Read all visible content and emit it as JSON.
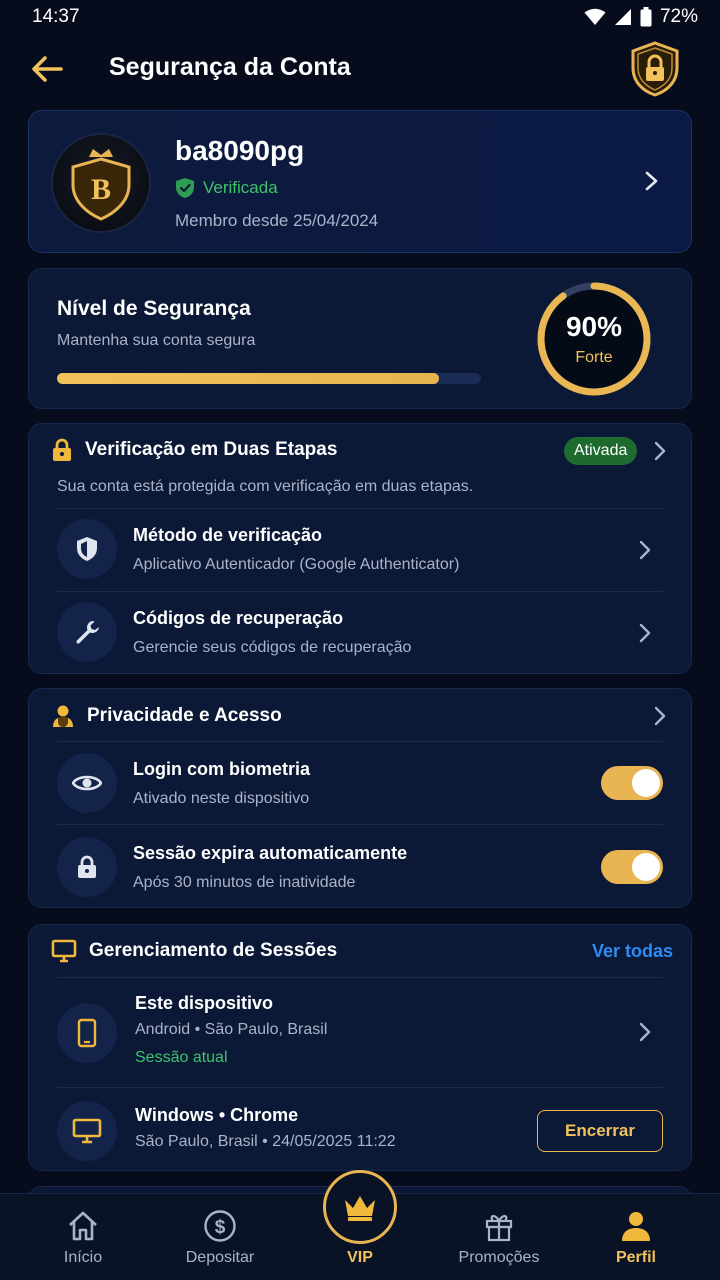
{
  "status": {
    "time": "14:37",
    "battery": "72%"
  },
  "header": {
    "title": "Segurança da Conta"
  },
  "profile": {
    "username": "ba8090pg",
    "verified_label": "Verificada",
    "member_since": "Membro desde 25/04/2024",
    "avatar_letter": "B"
  },
  "security_level": {
    "title": "Nível de Segurança",
    "subtitle": "Mantenha sua conta segura",
    "percent": 90,
    "percent_label": "90%",
    "strength": "Forte"
  },
  "two_factor": {
    "title": "Verificação em Duas Etapas",
    "status": "Ativada",
    "description": "Sua conta está protegida com verificação em duas etapas.",
    "items": [
      {
        "title": "Método de verificação",
        "subtitle": "Aplicativo Autenticador (Google Authenticator)"
      },
      {
        "title": "Códigos de recuperação",
        "subtitle": "Gerencie seus códigos de recuperação"
      }
    ]
  },
  "privacy": {
    "title": "Privacidade e Acesso",
    "items": [
      {
        "title": "Login com biometria",
        "subtitle": "Ativado neste dispositivo",
        "enabled": true
      },
      {
        "title": "Sessão expira automaticamente",
        "subtitle": "Após 30 minutos de inatividade",
        "enabled": true
      }
    ]
  },
  "sessions": {
    "title": "Gerenciamento de Sessões",
    "see_all": "Ver todas",
    "items": [
      {
        "title": "Este dispositivo",
        "subtitle": "Android • São Paulo, Brasil",
        "current_label": "Sessão atual"
      },
      {
        "title": "Windows • Chrome",
        "subtitle": "São Paulo, Brasil • 24/05/2025 11:22",
        "action": "Encerrar"
      }
    ]
  },
  "nav": {
    "items": [
      {
        "label": "Início",
        "icon": "home-icon"
      },
      {
        "label": "Depositar",
        "icon": "dollar-icon"
      },
      {
        "label": "VIP",
        "icon": "crown-icon"
      },
      {
        "label": "Promoções",
        "icon": "gift-icon"
      },
      {
        "label": "Perfil",
        "icon": "user-icon"
      }
    ],
    "active": "Perfil"
  },
  "colors": {
    "accent_gold": "#e9b552",
    "success_green": "#3ec26b",
    "link_blue": "#2f8cf2",
    "background": "#060c1c"
  }
}
